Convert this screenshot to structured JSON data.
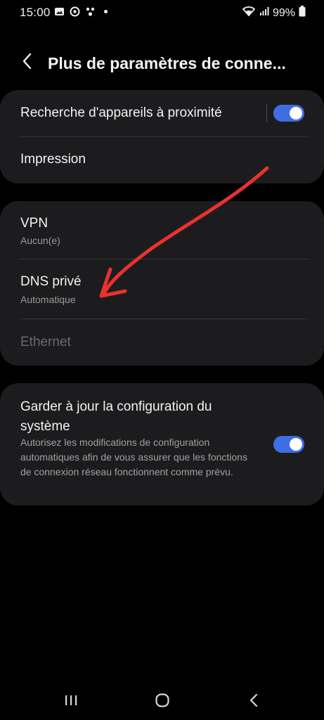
{
  "status_bar": {
    "time": "15:00",
    "battery": "99%",
    "left_icons": [
      "gallery-icon",
      "sync-icon",
      "assistant-icon",
      "dot-icon"
    ],
    "right_icons": [
      "wifi-icon",
      "signal-icon",
      "battery-icon"
    ]
  },
  "header": {
    "back_icon": "chevron-left-icon",
    "title": "Plus de paramètres de conne..."
  },
  "card1": {
    "nearby": {
      "label": "Recherche d'appareils à proximité",
      "enabled": true
    },
    "printing": {
      "label": "Impression"
    }
  },
  "card2": {
    "vpn": {
      "label": "VPN",
      "value": "Aucun(e)"
    },
    "private_dns": {
      "label": "DNS privé",
      "value": "Automatique"
    },
    "ethernet": {
      "label": "Ethernet",
      "disabled": true
    }
  },
  "card3": {
    "title": "Garder à jour la configuration du système",
    "description": "Autorisez les modifications de configuration automatiques afin de vous assurer que les fonctions de connexion réseau fonctionnent comme prévu.",
    "enabled": true
  },
  "nav_bar": {
    "items": [
      "recent-apps-icon",
      "home-icon",
      "back-icon"
    ]
  },
  "colors": {
    "background": "#000000",
    "card": "#1c1c1e",
    "accent": "#3e6ee3",
    "annotation": "#e8322e"
  }
}
